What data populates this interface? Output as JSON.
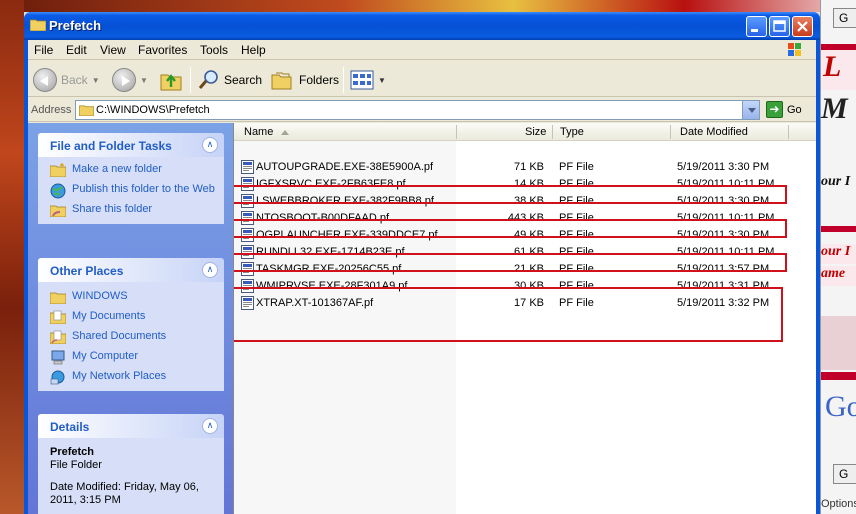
{
  "window": {
    "title": "Prefetch"
  },
  "menu": [
    "File",
    "Edit",
    "View",
    "Favorites",
    "Tools",
    "Help"
  ],
  "toolbar": {
    "back": "Back",
    "search": "Search",
    "folders": "Folders"
  },
  "address": {
    "label": "Address",
    "path": "C:\\WINDOWS\\Prefetch",
    "go": "Go"
  },
  "tasks_panel": {
    "title": "File and Folder Tasks",
    "items": [
      "Make a new folder",
      "Publish this folder to the Web",
      "Share this folder"
    ]
  },
  "places_panel": {
    "title": "Other Places",
    "items": [
      "WINDOWS",
      "My Documents",
      "Shared Documents",
      "My Computer",
      "My Network Places"
    ]
  },
  "details_panel": {
    "title": "Details",
    "name": "Prefetch",
    "kind": "File Folder",
    "modified": "Date Modified: Friday, May 06, 2011, 3:15 PM"
  },
  "columns": {
    "name": "Name",
    "size": "Size",
    "type": "Type",
    "date": "Date Modified"
  },
  "files": [
    {
      "name": "AUTOUPGRADE.EXE-38E5900A.pf",
      "size": "71 KB",
      "type": "PF File",
      "date": "5/19/2011 3:30 PM"
    },
    {
      "name": "IGFXSRVC.EXE-2FB63FE8.pf",
      "size": "14 KB",
      "type": "PF File",
      "date": "5/19/2011 10:11 PM"
    },
    {
      "name": "LSWEBBROKER.EXE-382F9BB8.pf",
      "size": "38 KB",
      "type": "PF File",
      "date": "5/19/2011 3:30 PM"
    },
    {
      "name": "NTOSBOOT-B00DFAAD.pf",
      "size": "443 KB",
      "type": "PF File",
      "date": "5/19/2011 10:11 PM"
    },
    {
      "name": "OGPLAUNCHER.EXE-339DDCE7.pf",
      "size": "49 KB",
      "type": "PF File",
      "date": "5/19/2011 3:30 PM"
    },
    {
      "name": "RUNDLL32.EXE-1714B23E.pf",
      "size": "61 KB",
      "type": "PF File",
      "date": "5/19/2011 10:11 PM"
    },
    {
      "name": "TASKMGR.EXE-20256C55.pf",
      "size": "21 KB",
      "type": "PF File",
      "date": "5/19/2011 3:57 PM"
    },
    {
      "name": "WMIPRVSE.EXE-28F301A9.pf",
      "size": "30 KB",
      "type": "PF File",
      "date": "5/19/2011 3:31 PM"
    },
    {
      "name": "XTRAP.XT-101367AF.pf",
      "size": "17 KB",
      "type": "PF File",
      "date": "5/19/2011 3:32 PM"
    }
  ],
  "highlight_color": "#d0101a",
  "desktop_right": {
    "button_a": "G",
    "button_b": "G",
    "ad_text_1": "L",
    "ad_text_2": "M",
    "ad_text_3": "our I",
    "ad_text_4": "our I",
    "ad_text_5": "ame",
    "logo": "Go",
    "options": "Options"
  }
}
